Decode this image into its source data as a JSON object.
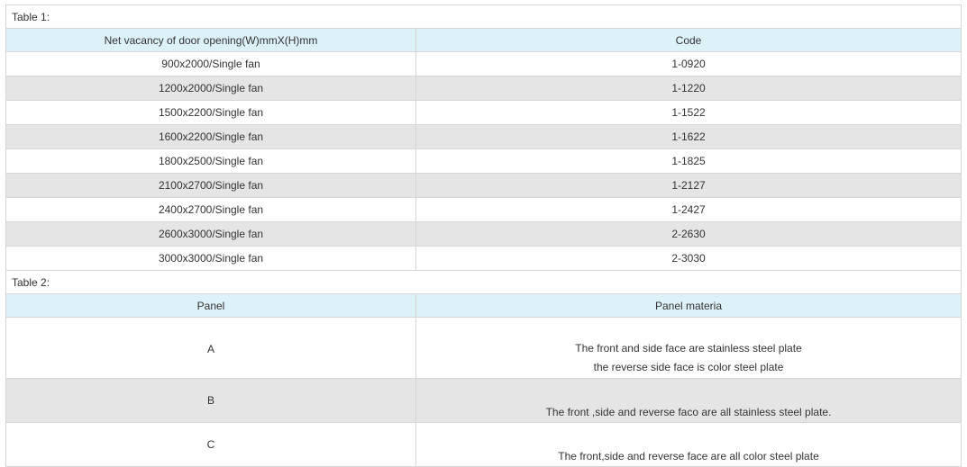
{
  "table1": {
    "caption": "Table  1:",
    "headers": [
      "Net vacancy of door opening(W)mmX(H)mm",
      "Code"
    ],
    "rows": [
      [
        "900x2000/Single fan",
        "1-0920"
      ],
      [
        "1200x2000/Single fan",
        "1-1220"
      ],
      [
        "1500x2200/Single fan",
        "1-1522"
      ],
      [
        "1600x2200/Single fan",
        "1-1622"
      ],
      [
        "1800x2500/Single fan",
        "1-1825"
      ],
      [
        "2100x2700/Single fan",
        "1-2127"
      ],
      [
        "2400x2700/Single fan",
        "1-2427"
      ],
      [
        "2600x3000/Single fan",
        "2-2630"
      ],
      [
        "3000x3000/Single fan",
        "2-3030"
      ]
    ]
  },
  "table2": {
    "caption": "Table  2:",
    "headers": [
      "Panel",
      "Panel materia"
    ],
    "rows": [
      {
        "panel": "A",
        "lines": [
          "The front and side face are stainless steel plate",
          "the reverse side face is color steel plate"
        ]
      },
      {
        "panel": "B",
        "lines": [
          "The front ,side and reverse faco are all stainless steel plate."
        ]
      },
      {
        "panel": "C",
        "lines": [
          "The front,side and reverse face are all color steel plate"
        ]
      }
    ]
  },
  "colors": {
    "header_bg": "#dcf1f8",
    "alt_row_bg": "#e5e5e5",
    "border": "#d6d6d6",
    "text": "#333333"
  }
}
